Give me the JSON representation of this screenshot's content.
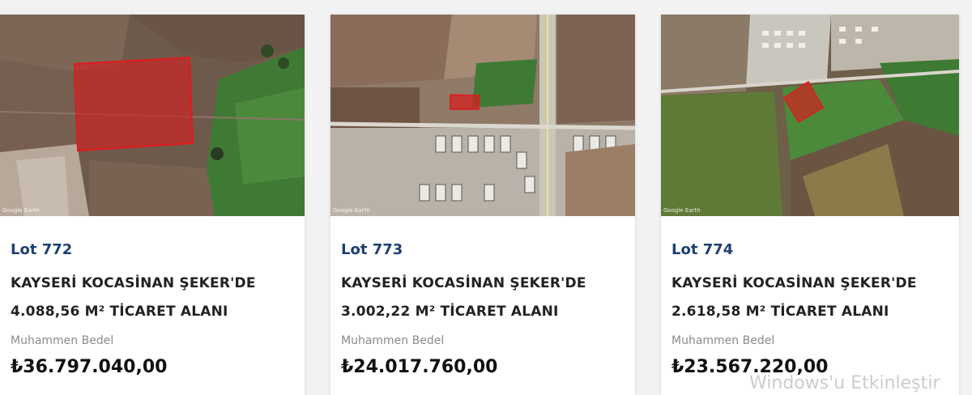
{
  "cards": [
    {
      "lot": "Lot 772",
      "title_line1": "KAYSERİ KOCASİNAN ŞEKER'DE",
      "title_line2": "4.088,56 M² TİCARET ALANI",
      "price_label": "Muhammen Bedel",
      "price": "₺36.797.040,00",
      "image_credit": "Google Earth"
    },
    {
      "lot": "Lot 773",
      "title_line1": "KAYSERİ KOCASİNAN ŞEKER'DE",
      "title_line2": "3.002,22 M² TİCARET ALANI",
      "price_label": "Muhammen Bedel",
      "price": "₺24.017.760,00",
      "image_credit": "Google Earth"
    },
    {
      "lot": "Lot 774",
      "title_line1": "KAYSERİ KOCASİNAN ŞEKER'DE",
      "title_line2": "2.618,58 M² TİCARET ALANI",
      "price_label": "Muhammen Bedel",
      "price": "₺23.567.220,00",
      "image_credit": "Google Earth"
    }
  ],
  "overlay_text": "Windows'u Etkinleştir",
  "colors": {
    "lot_blue": "#1f3f73",
    "parcel_red": "#d42020",
    "background": "#f2f2f2"
  }
}
